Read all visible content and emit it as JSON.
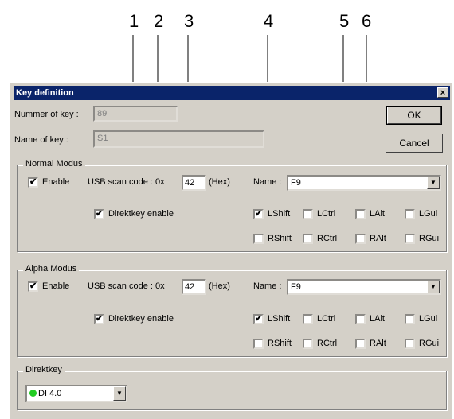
{
  "callouts": [
    "1",
    "2",
    "3",
    "4",
    "5",
    "6"
  ],
  "window": {
    "title": "Key definition",
    "close": "×"
  },
  "key": {
    "number_label": "Nummer of key :",
    "number_value": "89",
    "name_label": "Name of key :",
    "name_value": "S1"
  },
  "buttons": {
    "ok": "OK",
    "cancel": "Cancel"
  },
  "normal": {
    "title": "Normal Modus",
    "enable": "Enable",
    "usb_label": "USB scan code : 0x",
    "usb_value": "42",
    "hex": "(Hex)",
    "name_label": "Name :",
    "name_value": "F9",
    "direkt": "Direktkey enable",
    "mods": [
      "LShift",
      "LCtrl",
      "LAlt",
      "LGui",
      "RShift",
      "RCtrl",
      "RAlt",
      "RGui"
    ]
  },
  "alpha": {
    "title": "Alpha Modus",
    "enable": "Enable",
    "usb_label": "USB scan code : 0x",
    "usb_value": "42",
    "hex": "(Hex)",
    "name_label": "Name :",
    "name_value": "F9",
    "direkt": "Direktkey enable",
    "mods": [
      "LShift",
      "LCtrl",
      "LAlt",
      "LGui",
      "RShift",
      "RCtrl",
      "RAlt",
      "RGui"
    ]
  },
  "direktkey": {
    "title": "Direktkey",
    "value": "DI 4.0"
  },
  "check_mark": "✔",
  "dropdown_arrow": "▼",
  "colors": {
    "title_bar": "#0a246a",
    "dialog": "#d4d0c8",
    "status_dot": "#22cc22"
  }
}
